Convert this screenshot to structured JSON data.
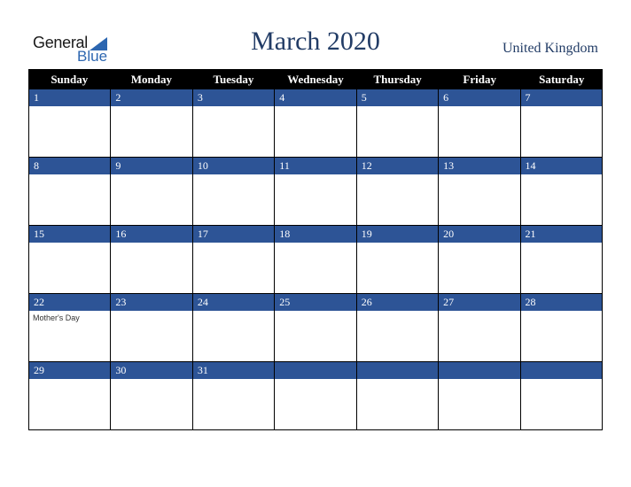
{
  "logo": {
    "word1": "General",
    "word2": "Blue"
  },
  "title": "March 2020",
  "country": "United Kingdom",
  "weekdays": [
    "Sunday",
    "Monday",
    "Tuesday",
    "Wednesday",
    "Thursday",
    "Friday",
    "Saturday"
  ],
  "weeks": [
    [
      {
        "day": "1",
        "event": ""
      },
      {
        "day": "2",
        "event": ""
      },
      {
        "day": "3",
        "event": ""
      },
      {
        "day": "4",
        "event": ""
      },
      {
        "day": "5",
        "event": ""
      },
      {
        "day": "6",
        "event": ""
      },
      {
        "day": "7",
        "event": ""
      }
    ],
    [
      {
        "day": "8",
        "event": ""
      },
      {
        "day": "9",
        "event": ""
      },
      {
        "day": "10",
        "event": ""
      },
      {
        "day": "11",
        "event": ""
      },
      {
        "day": "12",
        "event": ""
      },
      {
        "day": "13",
        "event": ""
      },
      {
        "day": "14",
        "event": ""
      }
    ],
    [
      {
        "day": "15",
        "event": ""
      },
      {
        "day": "16",
        "event": ""
      },
      {
        "day": "17",
        "event": ""
      },
      {
        "day": "18",
        "event": ""
      },
      {
        "day": "19",
        "event": ""
      },
      {
        "day": "20",
        "event": ""
      },
      {
        "day": "21",
        "event": ""
      }
    ],
    [
      {
        "day": "22",
        "event": "Mother's Day"
      },
      {
        "day": "23",
        "event": ""
      },
      {
        "day": "24",
        "event": ""
      },
      {
        "day": "25",
        "event": ""
      },
      {
        "day": "26",
        "event": ""
      },
      {
        "day": "27",
        "event": ""
      },
      {
        "day": "28",
        "event": ""
      }
    ],
    [
      {
        "day": "29",
        "event": ""
      },
      {
        "day": "30",
        "event": ""
      },
      {
        "day": "31",
        "event": ""
      },
      {
        "day": "",
        "event": ""
      },
      {
        "day": "",
        "event": ""
      },
      {
        "day": "",
        "event": ""
      },
      {
        "day": "",
        "event": ""
      }
    ]
  ],
  "colors": {
    "header_bg": "#000000",
    "date_bar": "#2d5496",
    "title": "#223c66",
    "logo_blue": "#2c66b0"
  }
}
